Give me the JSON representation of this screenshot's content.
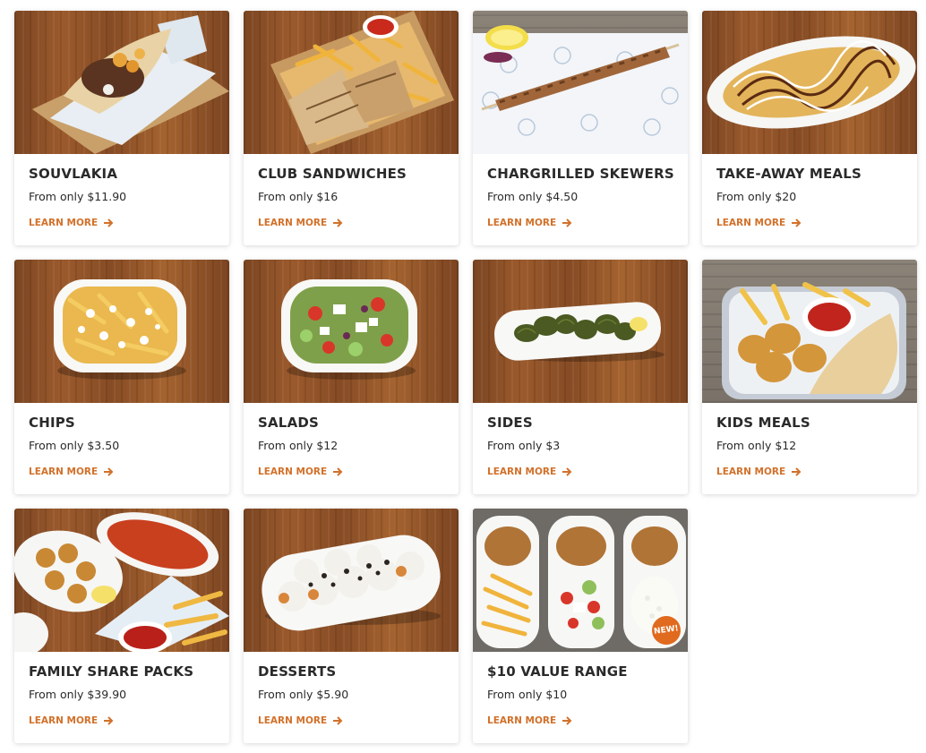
{
  "menu": {
    "learn_more_label": "LEARN MORE",
    "accent_color": "#d2712a",
    "items": [
      {
        "title": "SOUVLAKIA",
        "price": "From only $11.90",
        "image": "souvlaki-wrap-with-chips"
      },
      {
        "title": "CLUB SANDWICHES",
        "price": "From only $16",
        "image": "grilled-club-sandwiches-with-chips"
      },
      {
        "title": "CHARGRILLED SKEWERS",
        "price": "From only $4.50",
        "image": "chicken-skewer-with-lemon"
      },
      {
        "title": "TAKE-AWAY MEALS",
        "price": "From only $20",
        "image": "take-away-meal-platter"
      },
      {
        "title": "CHIPS",
        "price": "From only $3.50",
        "image": "chips-with-feta"
      },
      {
        "title": "SALADS",
        "price": "From only $12",
        "image": "greek-salad"
      },
      {
        "title": "SIDES",
        "price": "From only $3",
        "image": "dolmades-plate"
      },
      {
        "title": "KIDS MEALS",
        "price": "From only $12",
        "image": "nuggets-chips-and-sauce"
      },
      {
        "title": "FAMILY SHARE PACKS",
        "price": "From only $39.90",
        "image": "family-share-spread"
      },
      {
        "title": "DESSERTS",
        "price": "From only $5.90",
        "image": "loukoumades-dessert-plate"
      },
      {
        "title": "$10 VALUE RANGE",
        "price": "From only $10",
        "image": "value-range-three-plates",
        "badge": "NEW!"
      }
    ]
  }
}
